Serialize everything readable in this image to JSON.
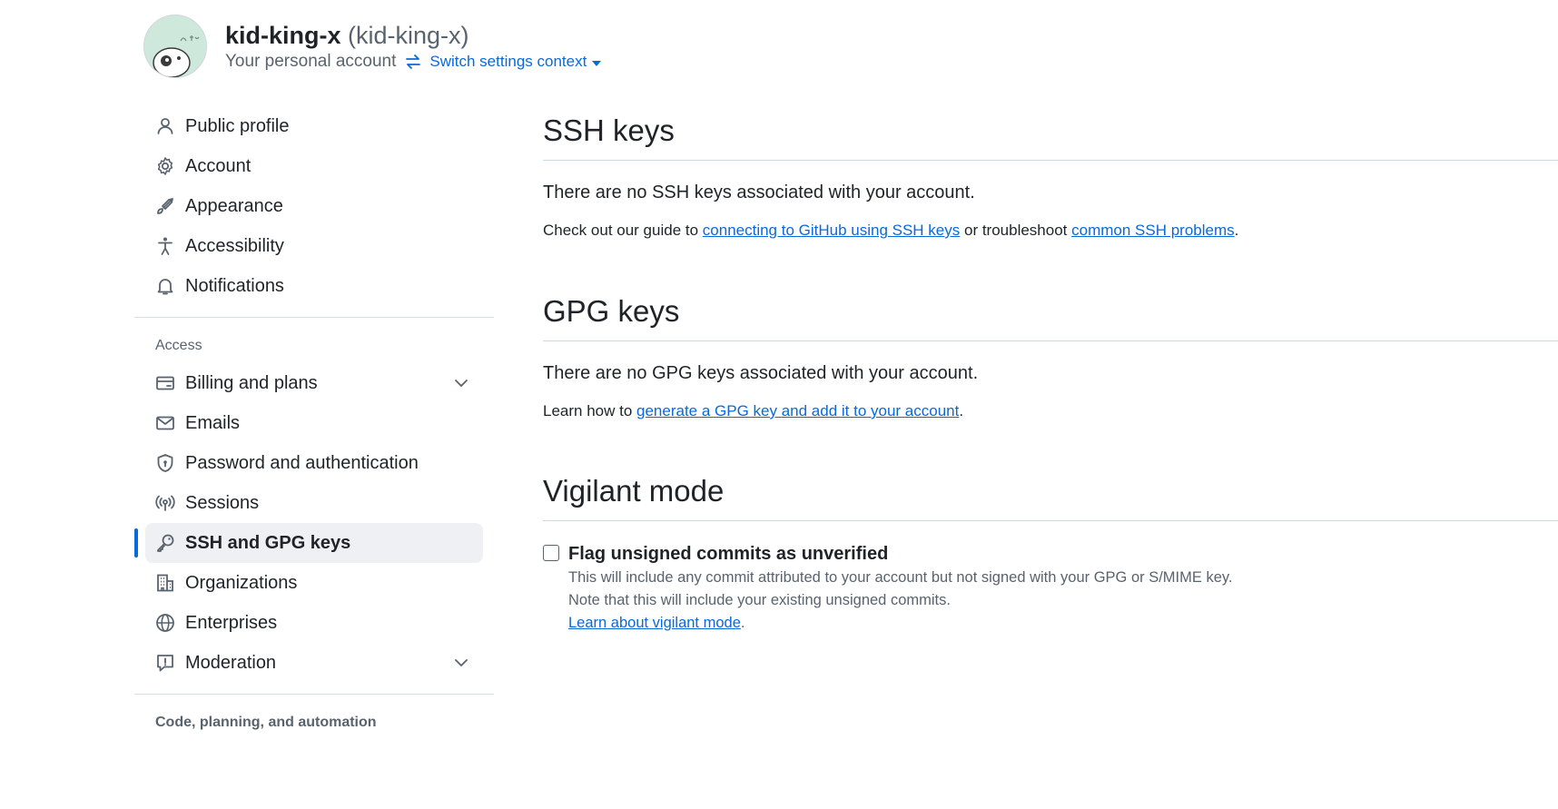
{
  "header": {
    "display_name": "kid-king-x",
    "handle": "(kid-king-x)",
    "subtitle": "Your personal account",
    "switch_label": "Switch settings context"
  },
  "sidebar": {
    "items_top": [
      {
        "label": "Public profile",
        "icon": "person-icon"
      },
      {
        "label": "Account",
        "icon": "gear-icon"
      },
      {
        "label": "Appearance",
        "icon": "paintbrush-icon"
      },
      {
        "label": "Accessibility",
        "icon": "accessibility-icon"
      },
      {
        "label": "Notifications",
        "icon": "bell-icon"
      }
    ],
    "access_label": "Access",
    "items_access": [
      {
        "label": "Billing and plans",
        "icon": "credit-card-icon",
        "expandable": true
      },
      {
        "label": "Emails",
        "icon": "mail-icon"
      },
      {
        "label": "Password and authentication",
        "icon": "shield-lock-icon"
      },
      {
        "label": "Sessions",
        "icon": "broadcast-icon"
      },
      {
        "label": "SSH and GPG keys",
        "icon": "key-icon",
        "active": true
      },
      {
        "label": "Organizations",
        "icon": "organization-icon"
      },
      {
        "label": "Enterprises",
        "icon": "globe-icon"
      },
      {
        "label": "Moderation",
        "icon": "report-icon",
        "expandable": true
      }
    ],
    "code_label": "Code, planning, and automation"
  },
  "main": {
    "ssh": {
      "title": "SSH keys",
      "empty": "There are no SSH keys associated with your account.",
      "guide_prefix": "Check out our guide to ",
      "guide_link": "connecting to GitHub using SSH keys",
      "guide_middle": " or troubleshoot ",
      "problems_link": "common SSH problems",
      "guide_suffix": "."
    },
    "gpg": {
      "title": "GPG keys",
      "empty": "There are no GPG keys associated with your account.",
      "learn_prefix": "Learn how to ",
      "learn_link": "generate a GPG key and add it to your account",
      "learn_suffix": "."
    },
    "vigilant": {
      "title": "Vigilant mode",
      "checkbox_label": "Flag unsigned commits as unverified",
      "checked": false,
      "note_line1": "This will include any commit attributed to your account but not signed with your GPG or S/MIME key.",
      "note_line2": "Note that this will include your existing unsigned commits.",
      "learn_link": "Learn about vigilant mode",
      "learn_suffix": "."
    }
  },
  "colors": {
    "accent": "#0969da",
    "active_bg": "#eef0f3",
    "muted_text": "#59636e"
  }
}
